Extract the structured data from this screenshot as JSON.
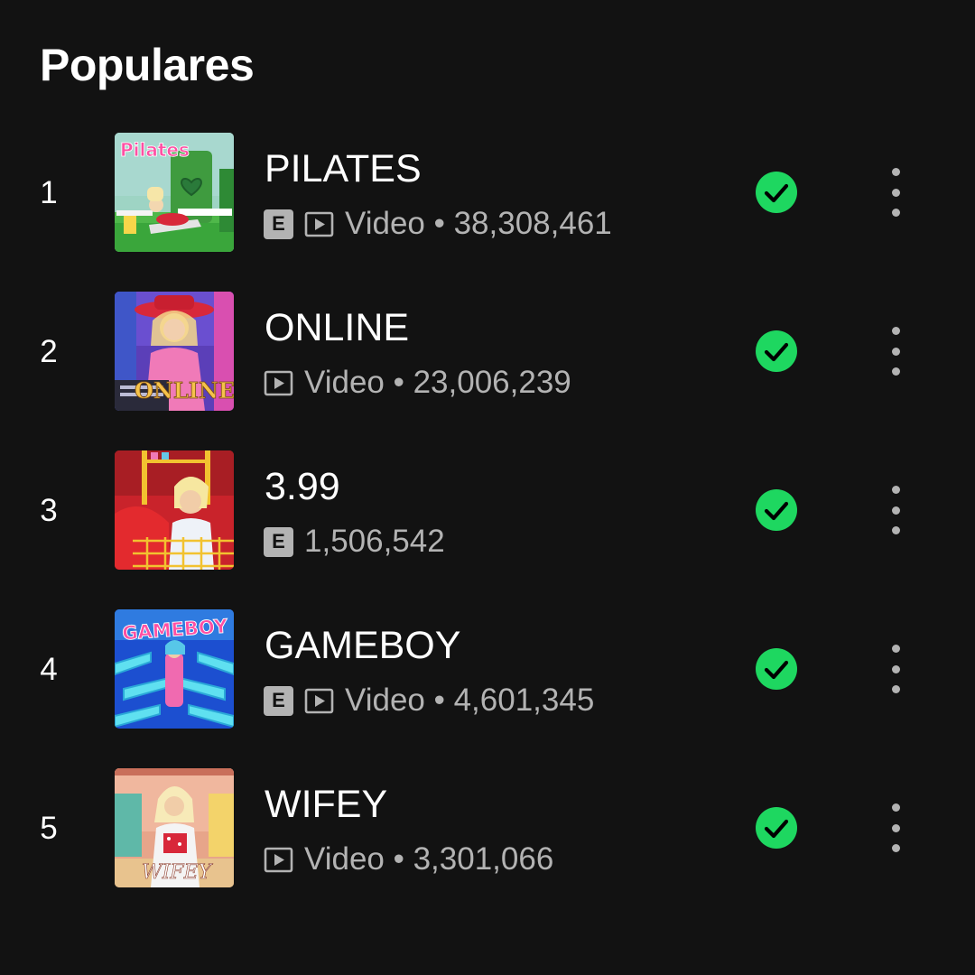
{
  "section": {
    "title": "Populares"
  },
  "colors": {
    "background": "#121212",
    "accent_green": "#1ed760",
    "secondary_text": "#b3b3b3"
  },
  "tracks": [
    {
      "rank": "1",
      "title": "PILATES",
      "explicit": true,
      "has_video": true,
      "meta": "Video • 38,308,461",
      "downloaded": true,
      "cover": "pink-lawn-cover"
    },
    {
      "rank": "2",
      "title": "ONLINE",
      "explicit": false,
      "has_video": true,
      "meta": "Video • 23,006,239",
      "downloaded": true,
      "cover": "pink-hat-gamer-cover"
    },
    {
      "rank": "3",
      "title": "3.99",
      "explicit": true,
      "has_video": false,
      "meta": "1,506,542",
      "downloaded": true,
      "cover": "red-shopping-cart-cover"
    },
    {
      "rank": "4",
      "title": "GAMEBOY",
      "explicit": true,
      "has_video": true,
      "meta": "Video • 4,601,345",
      "downloaded": true,
      "cover": "blue-maze-cover"
    },
    {
      "rank": "5",
      "title": "WIFEY",
      "explicit": false,
      "has_video": true,
      "meta": "Video • 3,301,066",
      "downloaded": true,
      "cover": "pastel-kitchen-cover"
    }
  ],
  "labels": {
    "explicit_badge": "E"
  },
  "icons": {
    "video": "video-play-icon",
    "downloaded": "downloaded-check-icon",
    "more": "more-options-icon"
  }
}
